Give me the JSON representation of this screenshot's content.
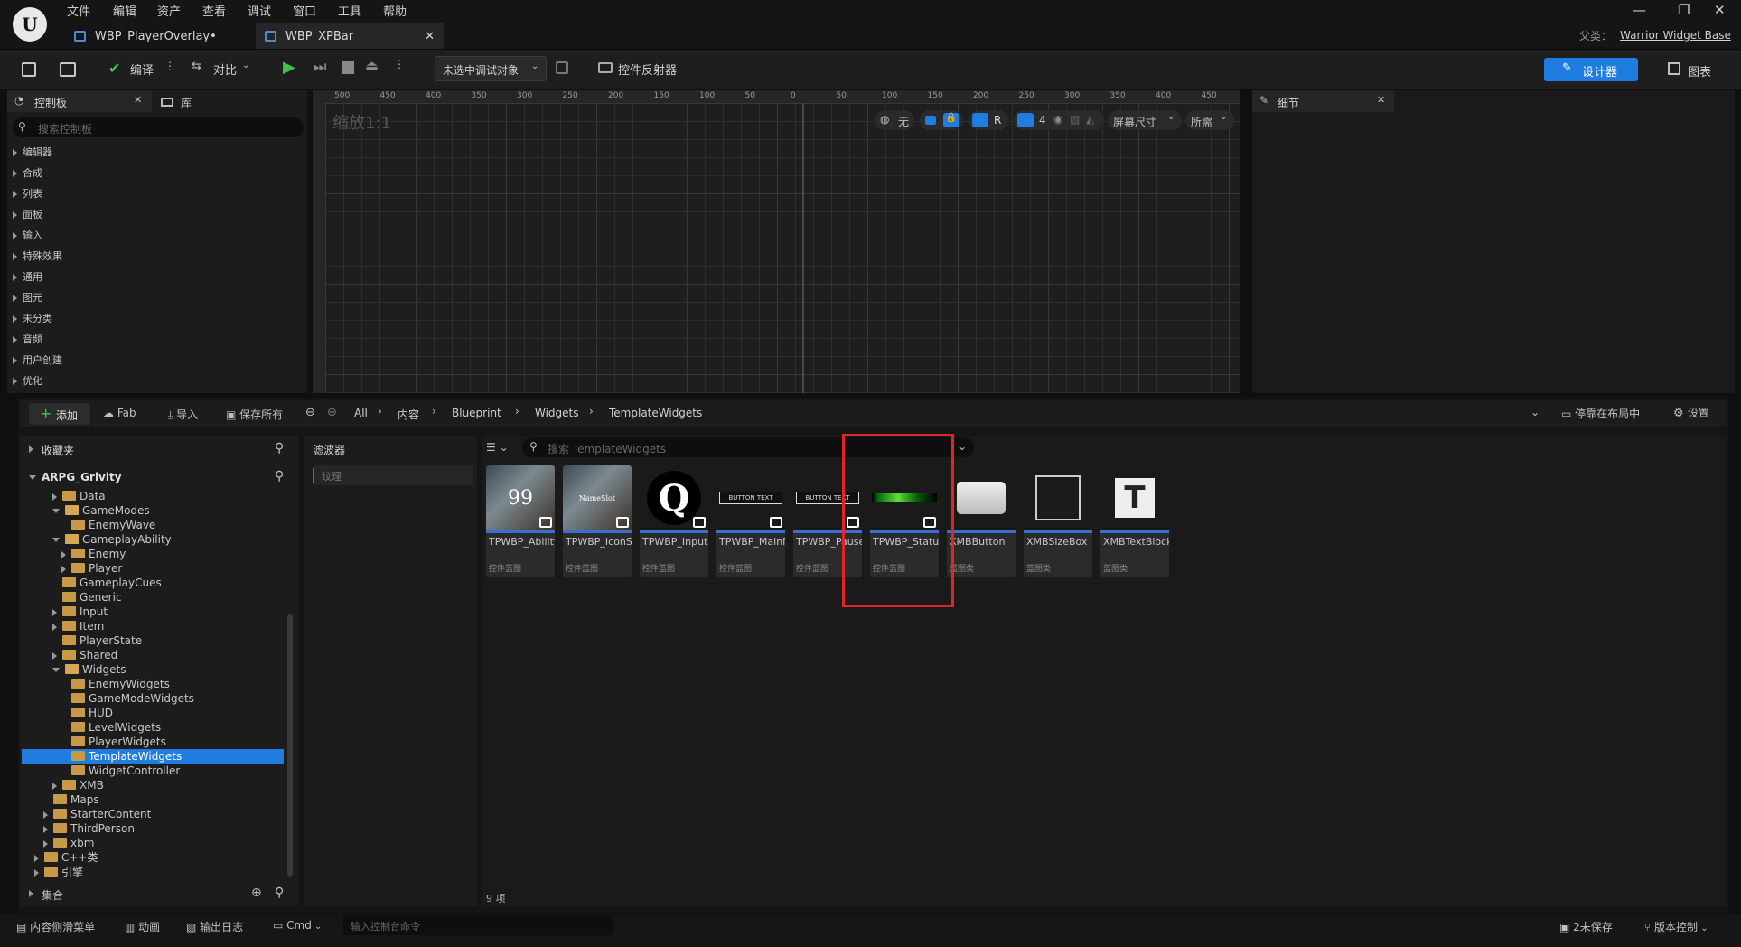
{
  "menu": [
    "文件",
    "编辑",
    "资产",
    "查看",
    "调试",
    "窗口",
    "工具",
    "帮助"
  ],
  "tabs": [
    {
      "label": "WBP_PlayerOverlay•"
    },
    {
      "label": "WBP_XPBar"
    }
  ],
  "parent_class": {
    "label": "父类：",
    "value": "Warrior Widget Base"
  },
  "toolbar": {
    "compile": "编译",
    "diff": "对比",
    "debug_target": "未选中调试对象",
    "reflector": "控件反射器",
    "designer": "设计器",
    "graph": "图表"
  },
  "palette": {
    "tab_palette": "控制板",
    "tab_library": "库",
    "search_placeholder": "搜索控制板",
    "categories": [
      "编辑器",
      "合成",
      "列表",
      "面板",
      "输入",
      "特殊效果",
      "通用",
      "图元",
      "未分类",
      "音频",
      "用户创建",
      "优化"
    ]
  },
  "canvas": {
    "zoom": "缩放1:1",
    "ruler_top": [
      "500",
      "450",
      "400",
      "350",
      "300",
      "250",
      "200",
      "150",
      "100",
      "50",
      "0",
      "50",
      "100",
      "150",
      "200",
      "250",
      "300",
      "350",
      "400",
      "450"
    ],
    "ctrl_none": "无",
    "ctrl_r": "R",
    "ctrl_4": "4",
    "screen_size": "屏幕尺寸",
    "fill": "所需"
  },
  "details": {
    "title": "细节"
  },
  "content": {
    "add": "添加",
    "fab": "Fab",
    "import": "导入",
    "save_all": "保存所有",
    "breadcrumbs": [
      "All",
      "内容",
      "Blueprint",
      "Widgets",
      "TemplateWidgets"
    ],
    "dock": "停靠在布局中",
    "settings": "设置",
    "favorites": "收藏夹",
    "project": "ARPG_Grivity",
    "filters": "滤波器",
    "filter_item": "纹理",
    "search_placeholder": "搜索 TemplateWidgets",
    "count": "9 项",
    "collections": "集合"
  },
  "tree": [
    {
      "label": "Data",
      "depth": 0,
      "arrow": "closed",
      "open": false
    },
    {
      "label": "GameModes",
      "depth": 0,
      "arrow": "open",
      "open": true
    },
    {
      "label": "EnemyWave",
      "depth": 1,
      "arrow": "none",
      "open": false
    },
    {
      "label": "GameplayAbility",
      "depth": 0,
      "arrow": "open",
      "open": true
    },
    {
      "label": "Enemy",
      "depth": 1,
      "arrow": "closed",
      "open": false
    },
    {
      "label": "Player",
      "depth": 1,
      "arrow": "closed",
      "open": false
    },
    {
      "label": "GameplayCues",
      "depth": 0,
      "arrow": "none",
      "open": false
    },
    {
      "label": "Generic",
      "depth": 0,
      "arrow": "none",
      "open": false
    },
    {
      "label": "Input",
      "depth": 0,
      "arrow": "closed",
      "open": false
    },
    {
      "label": "Item",
      "depth": 0,
      "arrow": "closed",
      "open": false
    },
    {
      "label": "PlayerState",
      "depth": 0,
      "arrow": "none",
      "open": false
    },
    {
      "label": "Shared",
      "depth": 0,
      "arrow": "closed",
      "open": false
    },
    {
      "label": "Widgets",
      "depth": 0,
      "arrow": "open",
      "open": true
    },
    {
      "label": "EnemyWidgets",
      "depth": 1,
      "arrow": "none",
      "open": false
    },
    {
      "label": "GameModeWidgets",
      "depth": 1,
      "arrow": "none",
      "open": false
    },
    {
      "label": "HUD",
      "depth": 1,
      "arrow": "none",
      "open": false
    },
    {
      "label": "LevelWidgets",
      "depth": 1,
      "arrow": "none",
      "open": false
    },
    {
      "label": "PlayerWidgets",
      "depth": 1,
      "arrow": "none",
      "open": false
    },
    {
      "label": "TemplateWidgets",
      "depth": 1,
      "arrow": "none",
      "open": false,
      "selected": true
    },
    {
      "label": "WidgetController",
      "depth": 1,
      "arrow": "none",
      "open": false
    },
    {
      "label": "XMB",
      "depth": 0,
      "arrow": "closed",
      "open": false
    },
    {
      "label": "Maps",
      "depth": -1,
      "arrow": "none",
      "open": false
    },
    {
      "label": "StarterContent",
      "depth": -1,
      "arrow": "closed",
      "open": false
    },
    {
      "label": "ThirdPerson",
      "depth": -1,
      "arrow": "closed",
      "open": false
    },
    {
      "label": "xbm",
      "depth": -1,
      "arrow": "closed",
      "open": false
    },
    {
      "label": "C++类",
      "depth": -2,
      "arrow": "closed",
      "open": false
    },
    {
      "label": "引擎",
      "depth": -2,
      "arrow": "closed",
      "open": false
    }
  ],
  "assets": [
    {
      "name": "TPWBP_AbilityIconSlot",
      "type": "控件蓝图",
      "thumb": "axe",
      "overlay": "99"
    },
    {
      "name": "TPWBP_IconSlot",
      "type": "控件蓝图",
      "thumb": "axe",
      "overlay": "NameSlot"
    },
    {
      "name": "TPWBP_InputKeySlot",
      "type": "控件蓝图",
      "thumb": "q",
      "overlay": "Q"
    },
    {
      "name": "TPWBP_MainMenuButton",
      "type": "控件蓝图",
      "thumb": "btn",
      "overlay": "BUTTON TEXT"
    },
    {
      "name": "TPWBP_PauseScreen...",
      "type": "控件蓝图",
      "thumb": "btn",
      "overlay": "BUTTON TEXT"
    },
    {
      "name": "TPWBP_StatusBar",
      "type": "控件蓝图",
      "thumb": "bar",
      "overlay": ""
    },
    {
      "name": "XMBButton",
      "type": "蓝图类",
      "thumb": "button",
      "overlay": ""
    },
    {
      "name": "XMBSizeBox",
      "type": "蓝图类",
      "thumb": "sizebox",
      "overlay": ""
    },
    {
      "name": "XMBTextBlock",
      "type": "蓝图类",
      "thumb": "text",
      "overlay": "T"
    }
  ],
  "status": {
    "drawer": "内容侧滑菜单",
    "anim": "动画",
    "log": "输出日志",
    "cmd": "Cmd",
    "cmd_placeholder": "输入控制台命令",
    "unsaved": "2未保存",
    "source": "版本控制"
  }
}
